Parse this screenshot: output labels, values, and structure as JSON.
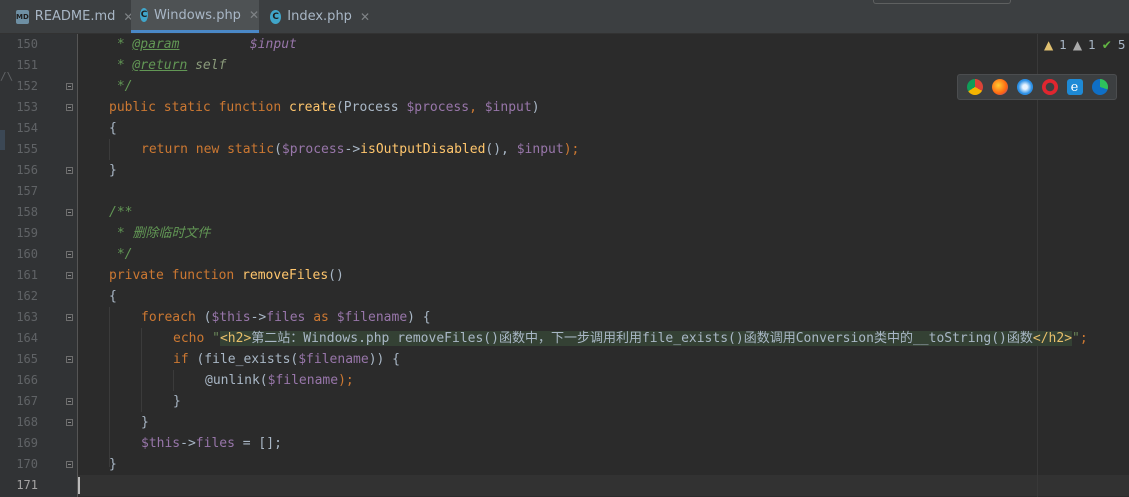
{
  "tabs": [
    {
      "label": "README.md",
      "icon": "markdown-file-icon",
      "active": false
    },
    {
      "label": "Windows.php",
      "icon": "php-class-icon",
      "active": true
    },
    {
      "label": "Index.php",
      "icon": "php-class-icon",
      "active": false
    }
  ],
  "gutter": {
    "line_numbers": [
      "150",
      "151",
      "152",
      "153",
      "154",
      "155",
      "156",
      "157",
      "158",
      "159",
      "160",
      "161",
      "162",
      "163",
      "164",
      "165",
      "166",
      "167",
      "168",
      "169",
      "170",
      "171"
    ],
    "current_line": "171"
  },
  "code": {
    "l150": {
      "a": " * ",
      "b": "@param",
      "c": "         ",
      "d": "$input"
    },
    "l151": {
      "a": " * ",
      "b": "@return",
      "c": " self"
    },
    "l152": {
      "a": " */"
    },
    "l153": {
      "a": "public static function ",
      "b": "create",
      "c": "(Process ",
      "d": "$process",
      "e": ", ",
      "f": "$input",
      "g": ")"
    },
    "l154": {
      "a": "{"
    },
    "l155": {
      "a": "return new static",
      "b": "(",
      "c": "$process",
      "d": "->",
      "e": "isOutputDisabled",
      "f": "(), ",
      "g": "$input",
      "h": ");"
    },
    "l156": {
      "a": "}"
    },
    "l158": {
      "a": "/**"
    },
    "l159": {
      "a": " * 删除临时文件"
    },
    "l160": {
      "a": " */"
    },
    "l161": {
      "a": "private function ",
      "b": "removeFiles",
      "c": "()"
    },
    "l162": {
      "a": "{"
    },
    "l163": {
      "a": "foreach",
      "b": " (",
      "c": "$this",
      "d": "->",
      "e": "files",
      "f": " as ",
      "g": "$filename",
      "h": ") {"
    },
    "l164": {
      "a": "echo ",
      "b": "\"",
      "c": "<h2>",
      "d": "第二站：Windows.php removeFiles()函数中，下一步调用利用file_exists()函数调用Conversion类中的__toString()函数",
      "e": "</h2>",
      "f": "\"",
      "g": ";"
    },
    "l165": {
      "a": "if",
      "b": " (file_exists(",
      "c": "$filename",
      "d": ")) {"
    },
    "l166": {
      "a": "@unlink(",
      "b": "$filename",
      "c": ");"
    },
    "l167": {
      "a": "}"
    },
    "l168": {
      "a": "}"
    },
    "l169": {
      "a": "$this",
      "b": "->",
      "c": "files",
      "d": " = [];"
    },
    "l170": {
      "a": "}"
    }
  },
  "inspections": {
    "warnings": "1",
    "weak_warnings": "1",
    "ok": "5"
  },
  "browsers": [
    "chrome-icon",
    "firefox-icon",
    "safari-icon",
    "opera-icon",
    "ie-icon",
    "edge-icon"
  ],
  "colors": {
    "keyword": "#cc7832",
    "function": "#ffc66d",
    "variable": "#9876aa",
    "doc": "#629755",
    "string": "#6a8759",
    "accent": "#4a88c7"
  }
}
